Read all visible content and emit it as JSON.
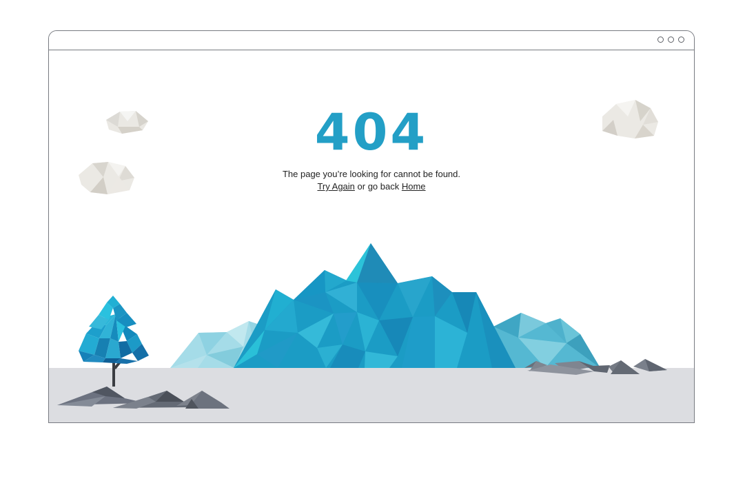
{
  "window": {
    "controls": [
      "circle-button",
      "circle-button",
      "circle-button"
    ]
  },
  "error": {
    "code": "404",
    "message": "The page you’re looking for cannot be found.",
    "try_again_label": "Try Again",
    "middle_text": " or go back ",
    "home_label": "Home"
  },
  "colors": {
    "accent": "#239fc6",
    "ground": "#dcdde1",
    "frame": "#777a80"
  }
}
